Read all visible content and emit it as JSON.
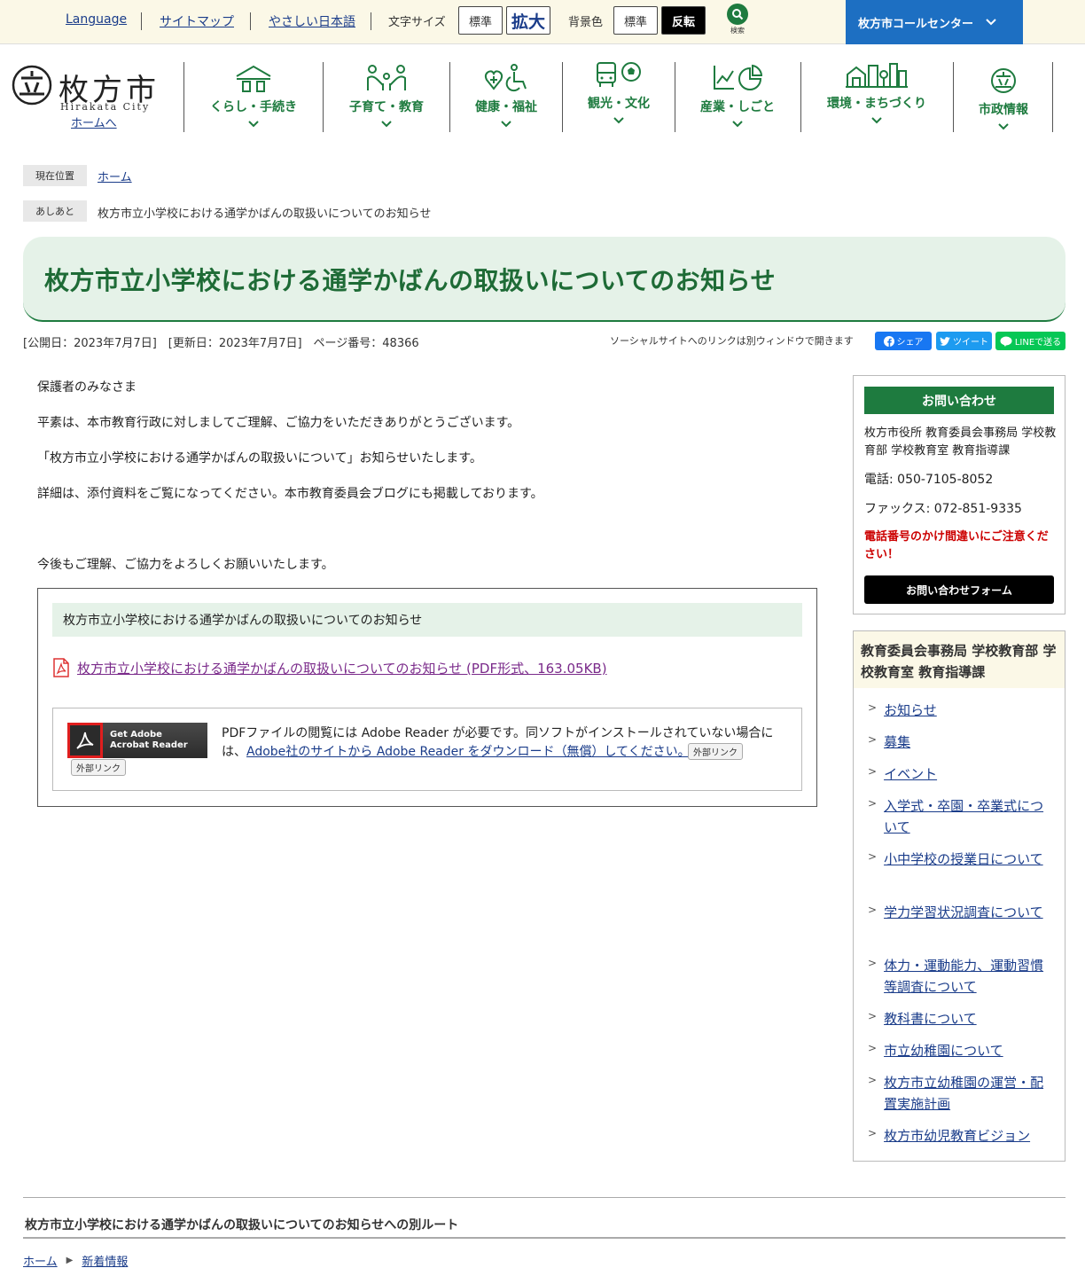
{
  "util": {
    "language": "Language",
    "sitemap": "サイトマップ",
    "easy_japanese": "やさしい日本語",
    "font_size_label": "文字サイズ",
    "font_standard": "標準",
    "font_large": "拡大",
    "bg_label": "背景色",
    "bg_standard": "標準",
    "bg_invert": "反転",
    "search": "検索",
    "call_center": "枚方市コールセンター"
  },
  "logo": {
    "kanji": "枚方市",
    "roman": "Hirakata City",
    "home_link": "ホームへ"
  },
  "global_nav": [
    {
      "label": "くらし・手続き",
      "icon": "house-icon"
    },
    {
      "label": "子育て・教育",
      "icon": "family-icon"
    },
    {
      "label": "健康・福祉",
      "icon": "health-wheelchair-icon"
    },
    {
      "label": "観光・文化",
      "icon": "bus-ball-icon"
    },
    {
      "label": "産業・しごと",
      "icon": "chart-icon"
    },
    {
      "label": "環境・まちづくり",
      "icon": "city-icon"
    },
    {
      "label": "市政情報",
      "icon": "city-emblem-icon"
    }
  ],
  "breadcrumb": {
    "current_label": "現在位置",
    "home": "ホーム",
    "footprint_label": "あしあと",
    "footprint_page": "枚方市立小学校における通学かばんの取扱いについてのお知らせ"
  },
  "page": {
    "title": "枚方市立小学校における通学かばんの取扱いについてのお知らせ",
    "meta": "[公開日：2023年7月7日]　[更新日：2023年7月7日]　ページ番号：48366",
    "social_note": "ソーシャルサイトへのリンクは別ウィンドウで開きます",
    "share_facebook": "シェア",
    "share_twitter": "ツイート",
    "share_line": "LINEで送る"
  },
  "body": {
    "p1": "保護者のみなさま",
    "p2": "平素は、本市教育行政に対しましてご理解、ご協力をいただきありがとうございます。",
    "p3": "「枚方市立小学校における通学かばんの取扱いについて」お知らせいたします。",
    "p4": "詳細は、添付資料をご覧になってください。本市教育委員会ブログにも掲載しております。",
    "p5": "今後もご理解、ご協力をよろしくお願いいたします。"
  },
  "attachment": {
    "heading": "枚方市立小学校における通学かばんの取扱いについてのお知らせ",
    "link": "枚方市立小学校における通学かばんの取扱いについてのお知らせ (PDF形式、163.05KB)",
    "adobe_badge_line1": "Get Adobe",
    "adobe_badge_line2": "Acrobat Reader",
    "external_tag": "外部リンク",
    "adobe_text": "PDFファイルの閲覧には Adobe Reader が必要です。同ソフトがインストールされていない場合には、",
    "adobe_link": "Adobe社のサイトから Adobe Reader をダウンロード（無償）してください。"
  },
  "contact": {
    "heading": "お問い合わせ",
    "dept": "枚方市役所 教育委員会事務局 学校教育部 学校教育室 教育指導課",
    "phone": "電話: 050-7105-8052",
    "fax": "ファックス: 072-851-9335",
    "warning": "電話番号のかけ間違いにご注意ください！",
    "form_button": "お問い合わせフォーム"
  },
  "dept_nav": {
    "heading": "教育委員会事務局 学校教育部 学校教育室 教育指導課",
    "items": [
      "お知らせ",
      "募集",
      "イベント",
      "入学式・卒園・卒業式について",
      "小中学校の授業日について",
      "学力学習状況調査について",
      "体力・運動能力、運動習慣等調査について",
      "教科書について",
      "市立幼稚園について",
      "枚方市立幼稚園の運営・配置実施計画",
      "枚方市幼児教育ビジョン"
    ]
  },
  "other_route": {
    "title": "枚方市立小学校における通学かばんの取扱いについてのお知らせへの別ルート",
    "crumbs": [
      "ホーム",
      "新着情報"
    ]
  },
  "colors": {
    "accent_green": "#1e7b3f",
    "call_center_blue": "#1d6fc2",
    "title_bg": "#e5f2e8",
    "util_bg": "#fbf8e7"
  }
}
